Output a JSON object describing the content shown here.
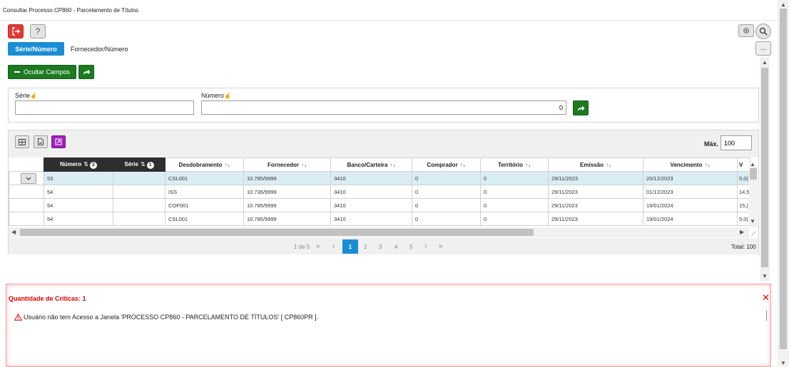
{
  "window": {
    "title": "Consultar Processo CP860 - Parcelamento de Títulos"
  },
  "toolbar": {
    "help_label": "?",
    "more_label": "..."
  },
  "tabs": [
    {
      "label": "Série/Número",
      "active": true
    },
    {
      "label": "Fornecedor/Número",
      "active": false
    }
  ],
  "actions": {
    "ocultar_label": "Ocultar Campos"
  },
  "fields": {
    "serie": {
      "label": "Série",
      "value": ""
    },
    "numero": {
      "label": "Número",
      "value": "0"
    }
  },
  "grid": {
    "max_label": "Máx.",
    "max_value": "100",
    "columns": [
      {
        "label": "Número",
        "badge": "2"
      },
      {
        "label": "Série",
        "badge": "1"
      },
      {
        "label": "Desdobramento"
      },
      {
        "label": "Fornecedor"
      },
      {
        "label": "Banco/Carteira"
      },
      {
        "label": "Comprador"
      },
      {
        "label": "Território"
      },
      {
        "label": "Emissão"
      },
      {
        "label": "Vencimento"
      },
      {
        "label": "V"
      }
    ],
    "rows": [
      [
        "53",
        "",
        "CSL001",
        "10.785/9999",
        "3410",
        "0",
        "0",
        "29/11/2023",
        "20/12/2023",
        "5,0("
      ],
      [
        "54",
        "",
        "ISS",
        "10.736/9999",
        "3410",
        "0",
        "0",
        "29/11/2023",
        "01/12/2023",
        "14,5"
      ],
      [
        "54",
        "",
        "COF001",
        "10.785/9999",
        "3410",
        "0",
        "0",
        "29/11/2023",
        "19/01/2024",
        "15,("
      ],
      [
        "54",
        "",
        "CSL001",
        "10.785/9999",
        "3410",
        "0",
        "0",
        "29/11/2023",
        "19/01/2024",
        "5,0("
      ]
    ]
  },
  "pager": {
    "info": "1 de 5",
    "first": "«",
    "prev": "‹",
    "pages": [
      "1",
      "2",
      "3",
      "4",
      "5"
    ],
    "next": "›",
    "last": "»",
    "total": "Total: 100"
  },
  "errors": {
    "title": "Quantidade de Críticas: 1",
    "message": "Usuário não tem Acesso a Janela 'PROCESSO CP860 - PARCELAMENTO DE TÍTULOS' [ CP860PR ].",
    "close": "✕"
  },
  "colors": {
    "primary": "#1b8ed3",
    "success": "#1d7a22",
    "danger": "#e03a35",
    "accent": "#a020b8",
    "error_text": "#e00000"
  }
}
